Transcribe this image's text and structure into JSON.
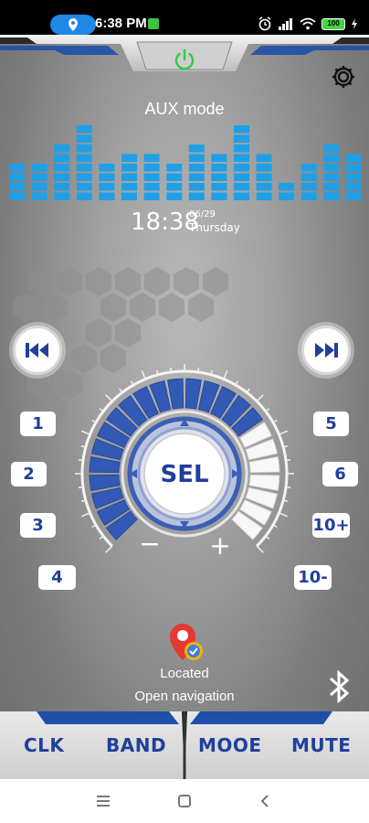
{
  "status_bar": {
    "time": "6:38 PM",
    "battery": "100"
  },
  "mode": {
    "title": "AUX mode"
  },
  "equalizer": {
    "bar_levels": [
      4,
      4,
      6,
      8,
      4,
      5,
      5,
      4,
      6,
      5,
      8,
      5,
      2,
      4,
      6,
      5
    ]
  },
  "clock": {
    "time": "18:38",
    "date": "06/29",
    "day": "Thursday"
  },
  "controls": {
    "prev_icon": "skip-previous-icon",
    "next_icon": "skip-next-icon",
    "select_label": "SEL",
    "minus_label": "−",
    "plus_label": "+",
    "volume_level": 0.72
  },
  "presets": {
    "left": [
      "1",
      "2",
      "3",
      "4"
    ],
    "right": [
      "5",
      "6",
      "10+",
      "10-"
    ]
  },
  "navigation": {
    "located": "Located",
    "open": "Open navigation"
  },
  "bottom_bar": {
    "clk": "CLK",
    "band": "BAND",
    "mode": "MOOE",
    "mute": "MUTE"
  },
  "colors": {
    "accent_blue": "#1f3f9a",
    "eq_blue": "#1fa0e6",
    "power_green": "#2ecc40"
  }
}
